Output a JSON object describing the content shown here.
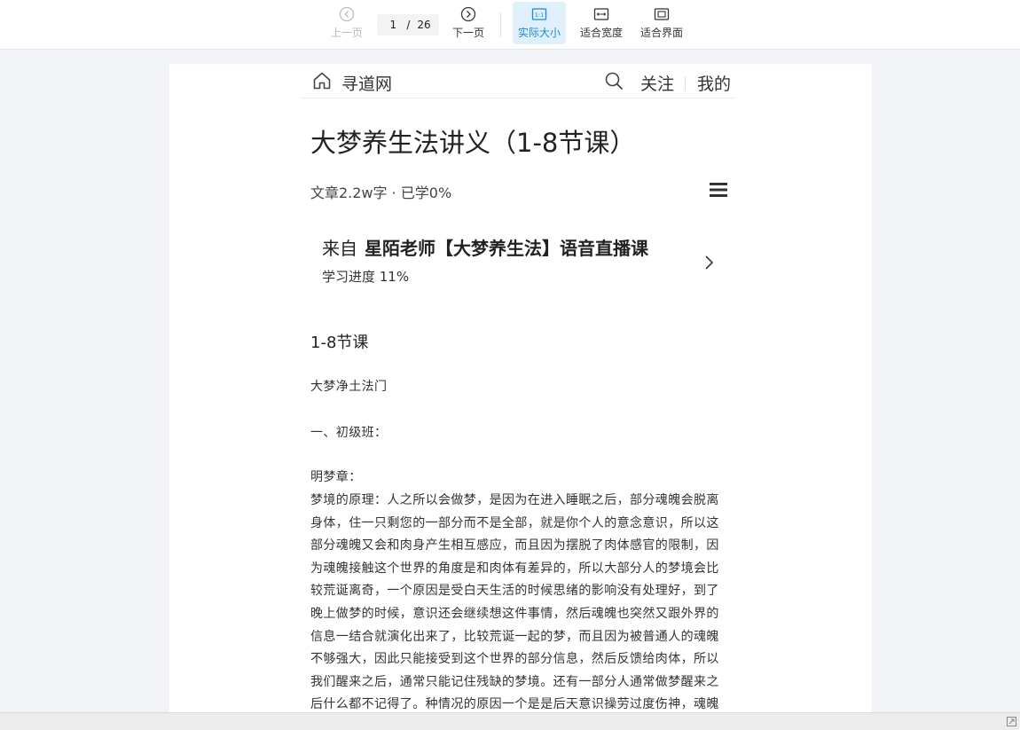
{
  "toolbar": {
    "prev_label": "上一页",
    "next_label": "下一页",
    "current_page": "1",
    "separator": "/",
    "total_pages": "26",
    "actual_size_label": "实际大小",
    "fit_width_label": "适合宽度",
    "fit_page_label": "适合界面",
    "active_mode": "actual_size",
    "accent_color": "#1a8ad8"
  },
  "site": {
    "name": "寻道网",
    "follow_label": "关注",
    "mine_label": "我的"
  },
  "doc": {
    "title": "大梦养生法讲义（1-8节课）",
    "meta": "文章2.2w字  · 已学0%"
  },
  "source": {
    "prefix": "来自",
    "name": "星陌老师【大梦养生法】语音直播课",
    "progress": "学习进度 11%"
  },
  "content": {
    "heading": "1-8节课",
    "line1": "大梦净土法门",
    "line2": "一、初级班：",
    "line3": "明梦章：",
    "main": "梦境的原理：人之所以会做梦，是因为在进入睡眠之后，部分魂魄会脱离身体，住一只剩您的一部分而不是全部，就是你个人的意念意识，所以这部分魂魄又会和肉身产生相互感应，而且因为摆脱了肉体感官的限制，因为魂魄接触这个世界的角度是和肉体有差异的，所以大部分人的梦境会比较荒诞离奇，一个原因是受白天生活的时候思绪的影响没有处理好，到了晚上做梦的时候，意识还会继续想这件事情，然后魂魄也突然又跟外界的信息一结合就演化出来了，比较荒诞一起的梦，而且因为被普通人的魂魄不够强大，因此只能接受到这个世界的部分信息，然后反馈给肉体，所以我们醒来之后，通常只能记住残缺的梦境。还有一部分人通常做梦醒来之后什么都不记得了。种情况的原因一个是是后天意识操劳过度伤神，魂魄不够强，你做了梦，他"
  }
}
